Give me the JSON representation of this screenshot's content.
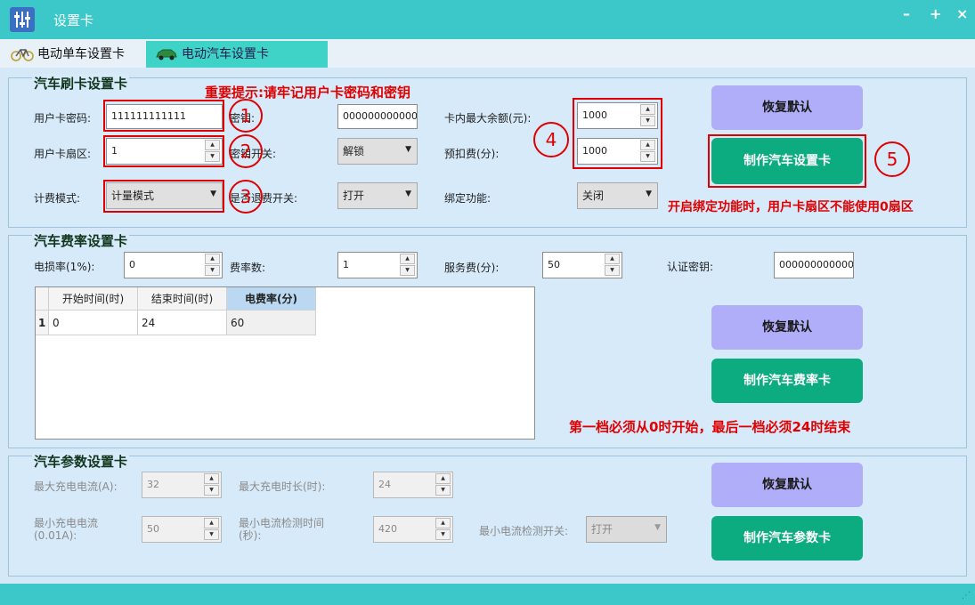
{
  "window": {
    "title": "设置卡",
    "minimize": "–",
    "maximize": "+",
    "close": "×"
  },
  "tabs": [
    {
      "label": "电动单车设置卡",
      "icon": "bicycle-icon"
    },
    {
      "label": "电动汽车设置卡",
      "icon": "car-icon"
    }
  ],
  "swipe": {
    "title": "汽车刷卡设置卡",
    "notice": "重要提示:请牢记用户卡密码和密钥",
    "user_pwd_label": "用户卡密码:",
    "user_pwd_value": "111111111111",
    "key_label": "密钥:",
    "key_value": "000000000000",
    "max_balance_label": "卡内最大余额(元):",
    "max_balance_value": "1000",
    "sector_label": "用户卡扇区:",
    "sector_value": "1",
    "key_switch_label": "密钥开关:",
    "key_switch_value": "解锁",
    "prepay_label": "预扣费(分):",
    "prepay_value": "1000",
    "billing_mode_label": "计费模式:",
    "billing_mode_value": "计量模式",
    "refund_switch_label": "是否退费开关:",
    "refund_switch_value": "打开",
    "bind_label": "绑定功能:",
    "bind_value": "关闭",
    "bind_warning": "开启绑定功能时，用户卡扇区不能使用0扇区",
    "reset_button": "恢复默认",
    "make_button": "制作汽车设置卡",
    "markers": [
      "1",
      "2",
      "3",
      "4",
      "5"
    ]
  },
  "rate": {
    "title": "汽车费率设置卡",
    "loss_label": "电损率(1%):",
    "loss_value": "0",
    "count_label": "费率数:",
    "count_value": "1",
    "service_label": "服务费(分):",
    "service_value": "50",
    "auth_label": "认证密钥:",
    "auth_value": "000000000000",
    "table": {
      "headers": [
        "开始时间(时)",
        "结束时间(时)",
        "电费率(分)"
      ],
      "rows": [
        {
          "index": "1",
          "cells": [
            "0",
            "24",
            "60"
          ]
        }
      ]
    },
    "reset_button": "恢复默认",
    "make_button": "制作汽车费率卡",
    "warning": "第一档必须从0时开始，最后一档必须24时结束"
  },
  "params": {
    "title": "汽车参数设置卡",
    "max_current_label": "最大充电电流(A):",
    "max_current_value": "32",
    "max_time_label": "最大充电时长(时):",
    "max_time_value": "24",
    "min_current_label_1": "最小充电电流",
    "min_current_label_2": "(0.01A):",
    "min_current_value": "50",
    "min_detect_time_label_1": "最小电流检测时间",
    "min_detect_time_label_2": "(秒):",
    "min_detect_time_value": "420",
    "min_detect_switch_label": "最小电流检测开关:",
    "min_detect_switch_value": "打开",
    "reset_button": "恢复默认",
    "make_button": "制作汽车参数卡"
  },
  "colors": {
    "titlebar": "#3cc8c8",
    "accent_green": "#0dab80",
    "button_purple": "#b0aef8",
    "warning_red": "#e00000"
  }
}
